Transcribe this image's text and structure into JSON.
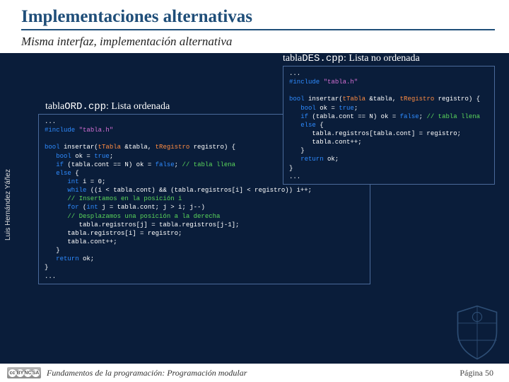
{
  "header": {
    "title": "Implementaciones alternativas",
    "subtitle": "Misma interfaz, implementación alternativa"
  },
  "des": {
    "label_prefix": "tabla",
    "label_file": "DES.cpp",
    "label_suffix": ": Lista no ordenada",
    "code_html": "...\n<span class='kw'>#include</span> <span class='st'>\"tabla.h\"</span>\n\n<span class='kw'>bool</span> insertar(<span class='ty'>tTabla</span> &amp;tabla, <span class='ty'>tRegistro</span> registro) {\n   <span class='kw'>bool</span> ok = <span class='kw'>true</span>;\n   <span class='kw'>if</span> (tabla.cont == N) ok = <span class='kw'>false</span>; <span class='cm'>// tabla llena</span>\n   <span class='kw'>else</span> {\n      tabla.registros[tabla.cont] = registro;\n      tabla.cont++;\n   }\n   <span class='kw'>return</span> ok;\n}\n..."
  },
  "ord": {
    "label_prefix": "tabla",
    "label_file": "ORD.cpp",
    "label_suffix": ": Lista ordenada",
    "code_html": "...\n<span class='kw'>#include</span> <span class='st'>\"tabla.h\"</span>\n\n<span class='kw'>bool</span> insertar(<span class='ty'>tTabla</span> &amp;tabla, <span class='ty'>tRegistro</span> registro) {\n   <span class='kw'>bool</span> ok = <span class='kw'>true</span>;\n   <span class='kw'>if</span> (tabla.cont == N) ok = <span class='kw'>false</span>; <span class='cm'>// tabla llena</span>\n   <span class='kw'>else</span> {\n      <span class='kw'>int</span> i = 0;\n      <span class='kw'>while</span> ((i &lt; tabla.cont) &amp;&amp; (tabla.registros[i] &lt; registro)) i++;\n      <span class='cm'>// Insertamos en la posición i</span>\n      <span class='kw'>for</span> (<span class='kw'>int</span> j = tabla.cont; j &gt; i; j--)\n      <span class='cm'>// Desplazamos una posición a la derecha</span>\n         tabla.registros[j] = tabla.registros[j-1];\n      tabla.registros[i] = registro;\n      tabla.cont++;\n   }\n   <span class='kw'>return</span> ok;\n}\n..."
  },
  "sidebar": {
    "author": "Luis Hernández Yáñez"
  },
  "footer": {
    "text": "Fundamentos de la programación: Programación modular",
    "page": "Página 50"
  },
  "cc": {
    "b1": "cc",
    "b2": "BY",
    "b3": "NC",
    "b4": "SA"
  },
  "colors": {
    "bg": "#0a1d3a",
    "accent": "#1f4e79"
  }
}
